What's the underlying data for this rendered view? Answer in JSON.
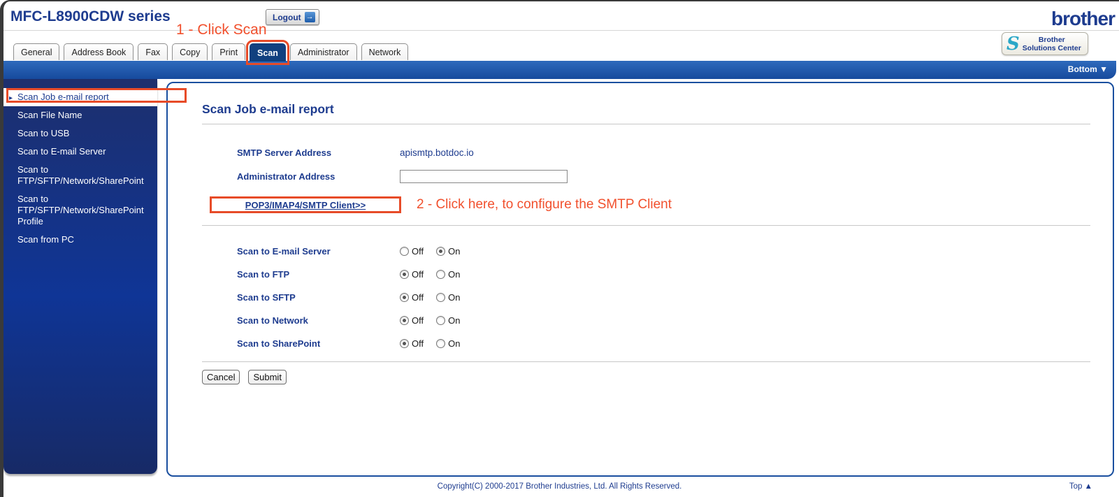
{
  "window": {
    "title": "MFC-L8900CDW series",
    "logout_label": "Logout",
    "logout_arrow": "→",
    "brand": "brother",
    "solutions_center": {
      "line1": "Brother",
      "line2": "Solutions Center"
    },
    "bottom_link": "Bottom ▼"
  },
  "annotations": {
    "step1": "1 - Click Scan",
    "step2": "2 - Click here, to configure the SMTP Client",
    "highlight_color": "#e74b28",
    "text_color": "#f1502d"
  },
  "tabs": [
    {
      "label": "General",
      "active": false
    },
    {
      "label": "Address Book",
      "active": false
    },
    {
      "label": "Fax",
      "active": false
    },
    {
      "label": "Copy",
      "active": false
    },
    {
      "label": "Print",
      "active": false
    },
    {
      "label": "Scan",
      "active": true,
      "annotated": true
    },
    {
      "label": "Administrator",
      "active": false
    },
    {
      "label": "Network",
      "active": false
    }
  ],
  "sidebar": {
    "items": [
      {
        "label": "Scan Job e-mail report",
        "selected": true,
        "annotated": true
      },
      {
        "label": "Scan File Name",
        "selected": false
      },
      {
        "label": "Scan to USB",
        "selected": false
      },
      {
        "label": "Scan to E-mail Server",
        "selected": false
      },
      {
        "label": "Scan to FTP/SFTP/Network/SharePoint",
        "selected": false
      },
      {
        "label": "Scan to FTP/SFTP/Network/SharePoint Profile",
        "selected": false
      },
      {
        "label": "Scan from PC",
        "selected": false
      }
    ]
  },
  "form": {
    "heading": "Scan Job e-mail report",
    "smtp_label": "SMTP Server Address",
    "smtp_value": "apismtp.botdoc.io",
    "admin_label": "Administrator Address",
    "admin_value": "",
    "client_link": "POP3/IMAP4/SMTP Client>>",
    "off_label": "Off",
    "on_label": "On",
    "toggles": [
      {
        "label": "Scan to E-mail Server",
        "value": "On"
      },
      {
        "label": "Scan to FTP",
        "value": "Off"
      },
      {
        "label": "Scan to SFTP",
        "value": "Off"
      },
      {
        "label": "Scan to Network",
        "value": "Off"
      },
      {
        "label": "Scan to SharePoint",
        "value": "Off"
      }
    ],
    "cancel_label": "Cancel",
    "submit_label": "Submit"
  },
  "footer": {
    "copyright": "Copyright(C) 2000-2017 Brother Industries, Ltd. All Rights Reserved.",
    "top_link": "Top ▲"
  },
  "colors": {
    "navy_text": "#1e3c8f",
    "band_blue_top": "#2e6abc",
    "band_blue_bottom": "#164a9d",
    "active_tab": "#11407f",
    "sidebar_mid": "#0f3596",
    "panel_border": "#1a4f9f",
    "teal_icon": "#2ba7c7"
  }
}
